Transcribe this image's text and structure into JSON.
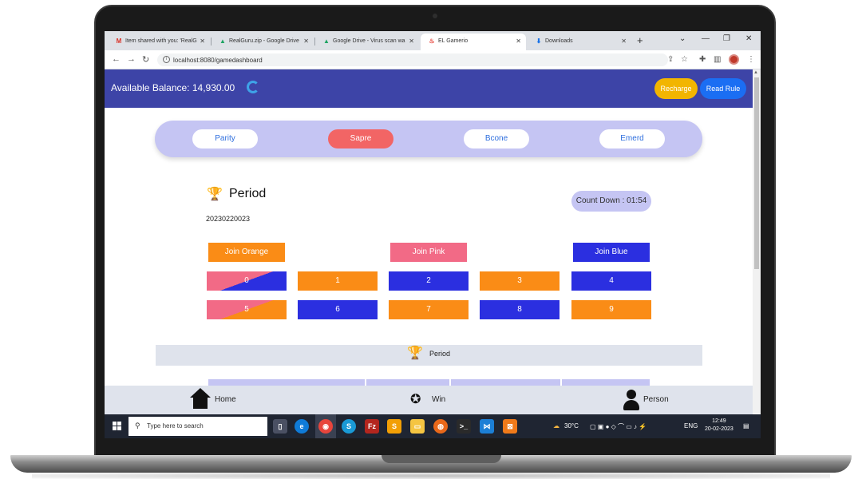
{
  "browser": {
    "tabs": [
      {
        "label": "Item shared with you: 'RealG",
        "icon": "gmail-icon"
      },
      {
        "label": "RealGuru.zip - Google Drive",
        "icon": "drive-icon"
      },
      {
        "label": "Google Drive - Virus scan wa",
        "icon": "drive-icon"
      },
      {
        "label": "EL Gamerio",
        "icon": "flame-icon"
      },
      {
        "label": "Downloads",
        "icon": "download-icon"
      }
    ],
    "new_tab": "+",
    "url": "localhost:8080/gamedashboard"
  },
  "header": {
    "balance": "Available Balance: 14,930.00",
    "recharge_label": "Recharge",
    "rule_label": "Read Rule"
  },
  "game_tabs": [
    "Parity",
    "Sapre",
    "Bcone",
    "Emerd"
  ],
  "active_game_tab": "Sapre",
  "period": {
    "title": "Period",
    "number": "20230220023",
    "countdown": "Count Down : 01:54"
  },
  "join": {
    "orange": "Join Orange",
    "pink": "Join Pink",
    "blue": "Join Blue"
  },
  "numbers": [
    "0",
    "1",
    "2",
    "3",
    "4",
    "5",
    "6",
    "7",
    "8",
    "9"
  ],
  "record_bar": {
    "title": "Period"
  },
  "bottom_nav": {
    "home": "Home",
    "win": "Win",
    "person": "Person"
  },
  "taskbar": {
    "search_placeholder": "Type here to search",
    "weather": "30°C",
    "language": "ENG",
    "time": "12:49",
    "date": "20-02-2023"
  },
  "colors": {
    "header": "#3d44a7",
    "orange": "#fa8c16",
    "blue": "#2b2fe0",
    "pink": "#f26a86",
    "recharge": "#f2b500",
    "read_rule": "#1b6ef3",
    "pill": "#c5c5f3"
  }
}
